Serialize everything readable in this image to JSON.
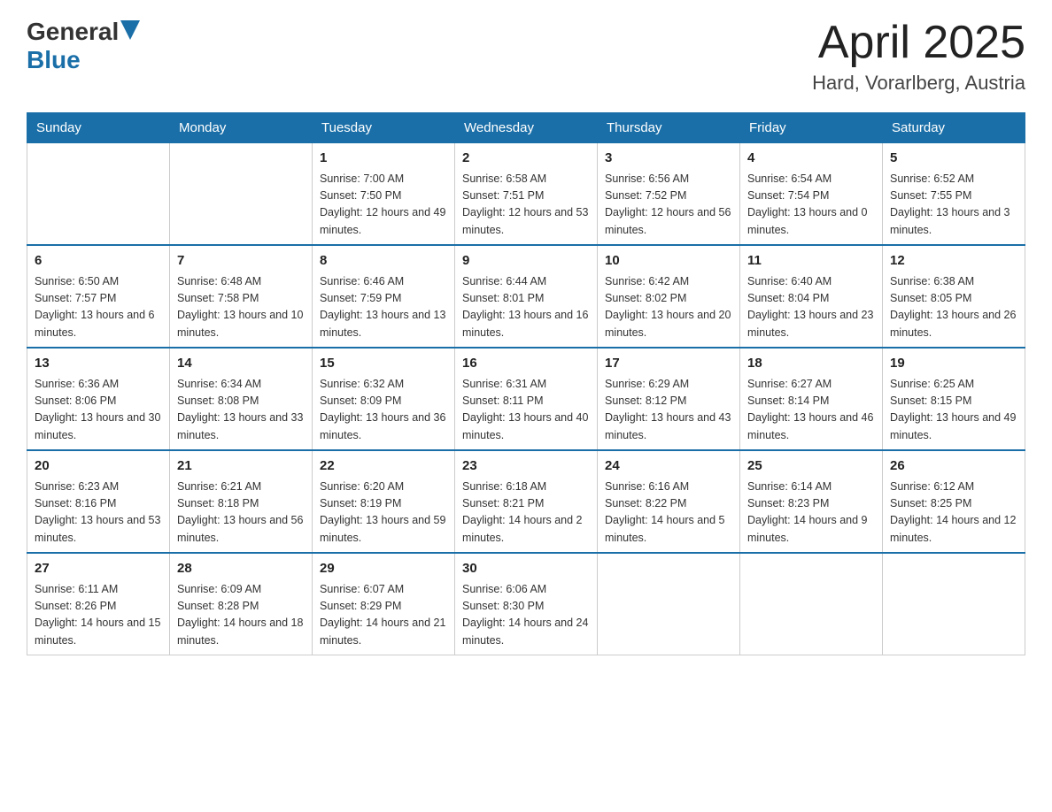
{
  "header": {
    "logo": {
      "general": "General",
      "blue": "Blue"
    },
    "title": "April 2025",
    "location": "Hard, Vorarlberg, Austria"
  },
  "weekdays": [
    "Sunday",
    "Monday",
    "Tuesday",
    "Wednesday",
    "Thursday",
    "Friday",
    "Saturday"
  ],
  "weeks": [
    [
      {
        "day": "",
        "sunrise": "",
        "sunset": "",
        "daylight": ""
      },
      {
        "day": "",
        "sunrise": "",
        "sunset": "",
        "daylight": ""
      },
      {
        "day": "1",
        "sunrise": "Sunrise: 7:00 AM",
        "sunset": "Sunset: 7:50 PM",
        "daylight": "Daylight: 12 hours and 49 minutes."
      },
      {
        "day": "2",
        "sunrise": "Sunrise: 6:58 AM",
        "sunset": "Sunset: 7:51 PM",
        "daylight": "Daylight: 12 hours and 53 minutes."
      },
      {
        "day": "3",
        "sunrise": "Sunrise: 6:56 AM",
        "sunset": "Sunset: 7:52 PM",
        "daylight": "Daylight: 12 hours and 56 minutes."
      },
      {
        "day": "4",
        "sunrise": "Sunrise: 6:54 AM",
        "sunset": "Sunset: 7:54 PM",
        "daylight": "Daylight: 13 hours and 0 minutes."
      },
      {
        "day": "5",
        "sunrise": "Sunrise: 6:52 AM",
        "sunset": "Sunset: 7:55 PM",
        "daylight": "Daylight: 13 hours and 3 minutes."
      }
    ],
    [
      {
        "day": "6",
        "sunrise": "Sunrise: 6:50 AM",
        "sunset": "Sunset: 7:57 PM",
        "daylight": "Daylight: 13 hours and 6 minutes."
      },
      {
        "day": "7",
        "sunrise": "Sunrise: 6:48 AM",
        "sunset": "Sunset: 7:58 PM",
        "daylight": "Daylight: 13 hours and 10 minutes."
      },
      {
        "day": "8",
        "sunrise": "Sunrise: 6:46 AM",
        "sunset": "Sunset: 7:59 PM",
        "daylight": "Daylight: 13 hours and 13 minutes."
      },
      {
        "day": "9",
        "sunrise": "Sunrise: 6:44 AM",
        "sunset": "Sunset: 8:01 PM",
        "daylight": "Daylight: 13 hours and 16 minutes."
      },
      {
        "day": "10",
        "sunrise": "Sunrise: 6:42 AM",
        "sunset": "Sunset: 8:02 PM",
        "daylight": "Daylight: 13 hours and 20 minutes."
      },
      {
        "day": "11",
        "sunrise": "Sunrise: 6:40 AM",
        "sunset": "Sunset: 8:04 PM",
        "daylight": "Daylight: 13 hours and 23 minutes."
      },
      {
        "day": "12",
        "sunrise": "Sunrise: 6:38 AM",
        "sunset": "Sunset: 8:05 PM",
        "daylight": "Daylight: 13 hours and 26 minutes."
      }
    ],
    [
      {
        "day": "13",
        "sunrise": "Sunrise: 6:36 AM",
        "sunset": "Sunset: 8:06 PM",
        "daylight": "Daylight: 13 hours and 30 minutes."
      },
      {
        "day": "14",
        "sunrise": "Sunrise: 6:34 AM",
        "sunset": "Sunset: 8:08 PM",
        "daylight": "Daylight: 13 hours and 33 minutes."
      },
      {
        "day": "15",
        "sunrise": "Sunrise: 6:32 AM",
        "sunset": "Sunset: 8:09 PM",
        "daylight": "Daylight: 13 hours and 36 minutes."
      },
      {
        "day": "16",
        "sunrise": "Sunrise: 6:31 AM",
        "sunset": "Sunset: 8:11 PM",
        "daylight": "Daylight: 13 hours and 40 minutes."
      },
      {
        "day": "17",
        "sunrise": "Sunrise: 6:29 AM",
        "sunset": "Sunset: 8:12 PM",
        "daylight": "Daylight: 13 hours and 43 minutes."
      },
      {
        "day": "18",
        "sunrise": "Sunrise: 6:27 AM",
        "sunset": "Sunset: 8:14 PM",
        "daylight": "Daylight: 13 hours and 46 minutes."
      },
      {
        "day": "19",
        "sunrise": "Sunrise: 6:25 AM",
        "sunset": "Sunset: 8:15 PM",
        "daylight": "Daylight: 13 hours and 49 minutes."
      }
    ],
    [
      {
        "day": "20",
        "sunrise": "Sunrise: 6:23 AM",
        "sunset": "Sunset: 8:16 PM",
        "daylight": "Daylight: 13 hours and 53 minutes."
      },
      {
        "day": "21",
        "sunrise": "Sunrise: 6:21 AM",
        "sunset": "Sunset: 8:18 PM",
        "daylight": "Daylight: 13 hours and 56 minutes."
      },
      {
        "day": "22",
        "sunrise": "Sunrise: 6:20 AM",
        "sunset": "Sunset: 8:19 PM",
        "daylight": "Daylight: 13 hours and 59 minutes."
      },
      {
        "day": "23",
        "sunrise": "Sunrise: 6:18 AM",
        "sunset": "Sunset: 8:21 PM",
        "daylight": "Daylight: 14 hours and 2 minutes."
      },
      {
        "day": "24",
        "sunrise": "Sunrise: 6:16 AM",
        "sunset": "Sunset: 8:22 PM",
        "daylight": "Daylight: 14 hours and 5 minutes."
      },
      {
        "day": "25",
        "sunrise": "Sunrise: 6:14 AM",
        "sunset": "Sunset: 8:23 PM",
        "daylight": "Daylight: 14 hours and 9 minutes."
      },
      {
        "day": "26",
        "sunrise": "Sunrise: 6:12 AM",
        "sunset": "Sunset: 8:25 PM",
        "daylight": "Daylight: 14 hours and 12 minutes."
      }
    ],
    [
      {
        "day": "27",
        "sunrise": "Sunrise: 6:11 AM",
        "sunset": "Sunset: 8:26 PM",
        "daylight": "Daylight: 14 hours and 15 minutes."
      },
      {
        "day": "28",
        "sunrise": "Sunrise: 6:09 AM",
        "sunset": "Sunset: 8:28 PM",
        "daylight": "Daylight: 14 hours and 18 minutes."
      },
      {
        "day": "29",
        "sunrise": "Sunrise: 6:07 AM",
        "sunset": "Sunset: 8:29 PM",
        "daylight": "Daylight: 14 hours and 21 minutes."
      },
      {
        "day": "30",
        "sunrise": "Sunrise: 6:06 AM",
        "sunset": "Sunset: 8:30 PM",
        "daylight": "Daylight: 14 hours and 24 minutes."
      },
      {
        "day": "",
        "sunrise": "",
        "sunset": "",
        "daylight": ""
      },
      {
        "day": "",
        "sunrise": "",
        "sunset": "",
        "daylight": ""
      },
      {
        "day": "",
        "sunrise": "",
        "sunset": "",
        "daylight": ""
      }
    ]
  ]
}
